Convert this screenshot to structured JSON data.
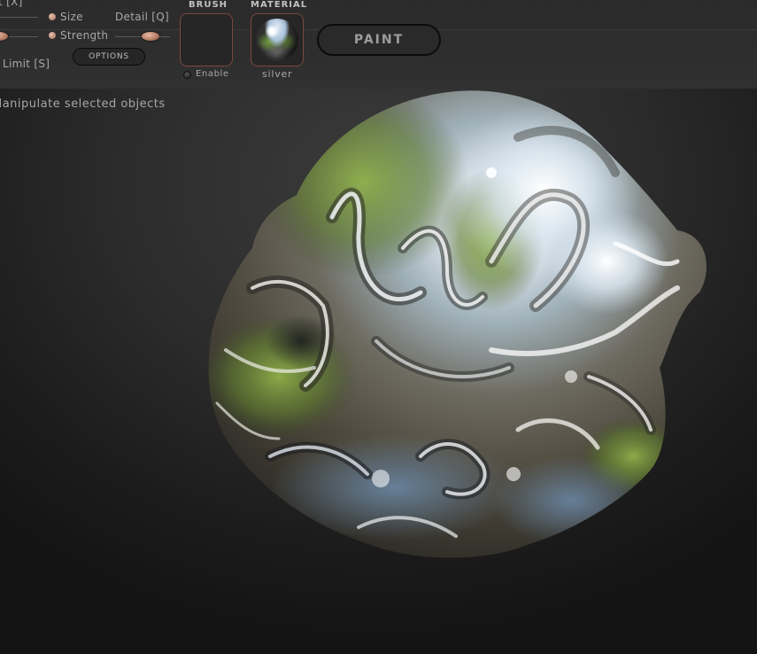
{
  "toolbar": {
    "invert_label": "Invert [X]",
    "size_label": "Size",
    "detail_label": "Detail [Q]",
    "strength_label": "Strength",
    "limit_label": "Limit [S]",
    "options_label": "OPTIONS",
    "brush_header": "BRUSH",
    "material_header": "MATERIAL",
    "enable_label": "Enable",
    "material_name": "silver",
    "paint_label": "PAINT"
  },
  "hint": {
    "text": "Manipulate selected objects"
  },
  "colors": {
    "accent_knob": "#c58c73",
    "slot_border": "#7a4a3c",
    "background": "#2c2c2c"
  }
}
